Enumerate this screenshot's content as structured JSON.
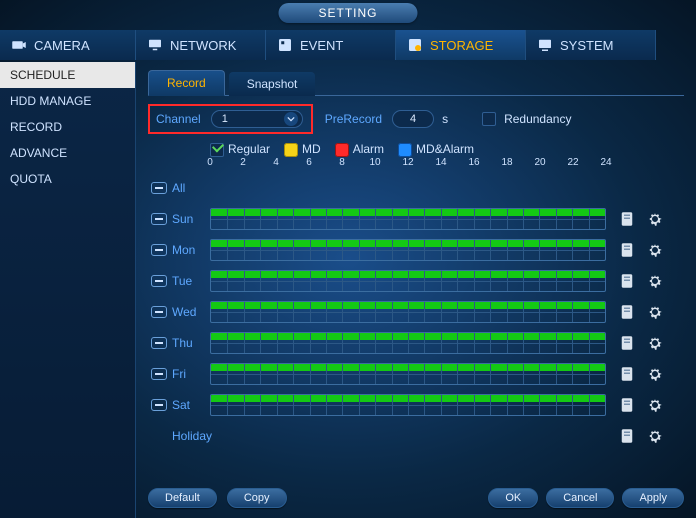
{
  "title": "SETTING",
  "main_tabs": {
    "camera": "CAMERA",
    "network": "NETWORK",
    "event": "EVENT",
    "storage": "STORAGE",
    "system": "SYSTEM",
    "active": "storage"
  },
  "sidebar": {
    "items": [
      "SCHEDULE",
      "HDD MANAGE",
      "RECORD",
      "ADVANCE",
      "QUOTA"
    ],
    "active_index": 0
  },
  "sub_tabs": {
    "record": "Record",
    "snapshot": "Snapshot",
    "active": "record"
  },
  "options": {
    "channel_label": "Channel",
    "channel_value": "1",
    "prerecord_label": "PreRecord",
    "prerecord_value": "4",
    "prerecord_unit": "s",
    "redundancy_label": "Redundancy",
    "redundancy_checked": false
  },
  "legend": {
    "regular": "Regular",
    "md": "MD",
    "alarm": "Alarm",
    "md_alarm": "MD&Alarm"
  },
  "timeline": {
    "ticks": [
      "0",
      "2",
      "4",
      "6",
      "8",
      "10",
      "12",
      "14",
      "16",
      "18",
      "20",
      "22",
      "24"
    ]
  },
  "days": {
    "all": "All",
    "list": [
      "Sun",
      "Mon",
      "Tue",
      "Wed",
      "Thu",
      "Fri",
      "Sat"
    ],
    "holiday": "Holiday"
  },
  "buttons": {
    "default": "Default",
    "copy": "Copy",
    "ok": "OK",
    "cancel": "Cancel",
    "apply": "Apply"
  },
  "colors": {
    "accent": "#ffb400",
    "link": "#5ea8ff",
    "regular": "#14c914",
    "md": "#f6d318",
    "alarm": "#ff2a2a",
    "md_alarm": "#1f8cff"
  }
}
